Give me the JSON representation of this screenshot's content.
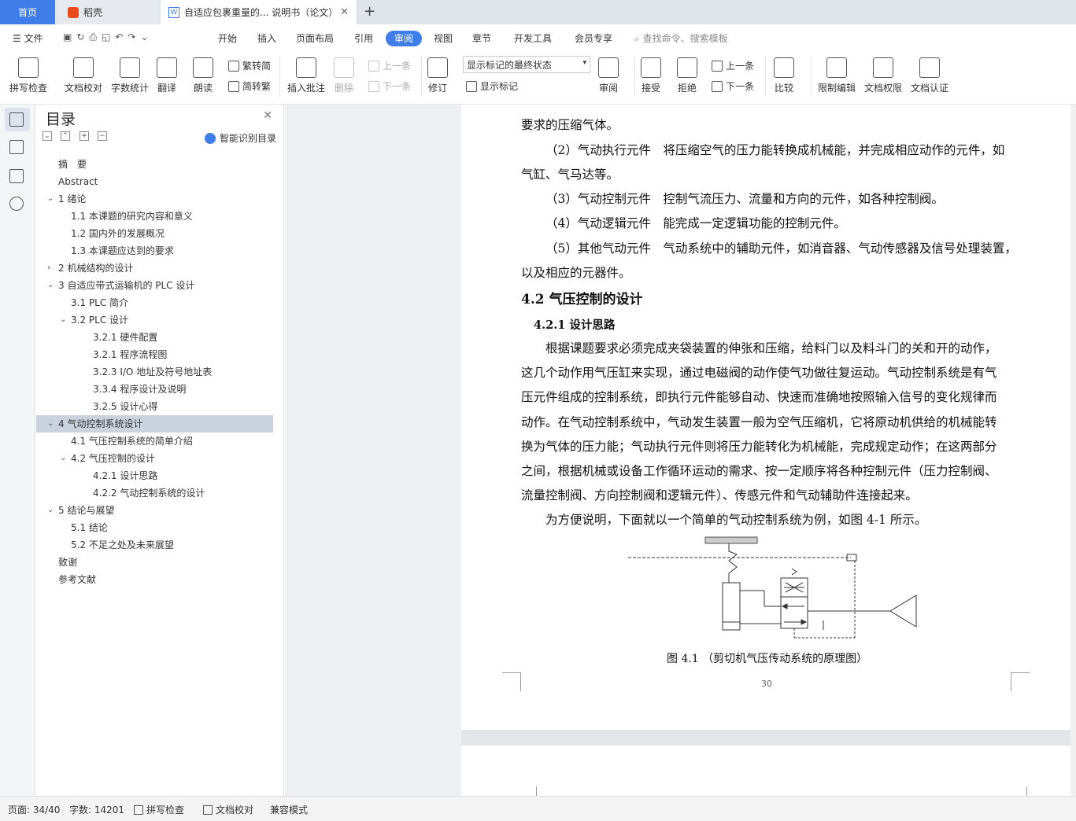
{
  "tabs": {
    "home": "首页",
    "daoke": "稻壳",
    "doc": "自适应包裹重量的... 说明书（论文）"
  },
  "menu": {
    "file": "文件",
    "items": [
      "开始",
      "插入",
      "页面布局",
      "引用",
      "审阅",
      "视图",
      "章节",
      "开发工具",
      "会员专享"
    ],
    "active": "审阅",
    "search": "查找命令、搜索模板"
  },
  "ribbon": {
    "spell": "拼写检查",
    "doc_check": "文档校对",
    "word_count": "字数统计",
    "translate": "翻译",
    "read": "朗读",
    "trad_simp": "繁转简",
    "simp_trad": "简转繁",
    "insert_comment": "插入批注",
    "delete": "删除",
    "prev1": "上一条",
    "next1": "下一条",
    "revise": "修订",
    "markup_state": "显示标记的最终状态",
    "show_markup": "显示标记",
    "review": "审阅",
    "accept": "接受",
    "reject": "拒绝",
    "prev2": "上一条",
    "next2": "下一条",
    "compare": "比较",
    "restrict": "限制编辑",
    "doc_perm": "文档权限",
    "doc_auth": "文档认证"
  },
  "toc": {
    "title": "目录",
    "smart": "智能识别目录",
    "items": [
      {
        "text": "摘　要",
        "level": 1
      },
      {
        "text": "Abstract",
        "level": 1
      },
      {
        "text": "1  绪论",
        "level": 1,
        "toggle": "open"
      },
      {
        "text": "1.1  本课题的研究内容和意义",
        "level": 2
      },
      {
        "text": "1.2  国内外的发展概况",
        "level": 2
      },
      {
        "text": "1.3  本课题应达到的要求",
        "level": 2
      },
      {
        "text": "2  机械结构的设计",
        "level": 1,
        "toggle": "closed"
      },
      {
        "text": "3  自适应带式运输机的 PLC 设计",
        "level": 1,
        "toggle": "open"
      },
      {
        "text": "3.1 PLC 简介",
        "level": 2
      },
      {
        "text": "3.2 PLC 设计",
        "level": 2,
        "toggle": "open"
      },
      {
        "text": "3.2.1  硬件配置",
        "level": 3
      },
      {
        "text": "3.2.1  程序流程图",
        "level": 3
      },
      {
        "text": "3.2.3 I/O 地址及符号地址表",
        "level": 3
      },
      {
        "text": "3.3.4  程序设计及说明",
        "level": 3
      },
      {
        "text": "3.2.5  设计心得",
        "level": 3
      },
      {
        "text": "4  气动控制系统设计",
        "level": 1,
        "toggle": "open",
        "selected": true
      },
      {
        "text": "4.1  气压控制系统的简单介绍",
        "level": 2
      },
      {
        "text": "4.2  气压控制的设计",
        "level": 2,
        "toggle": "open"
      },
      {
        "text": "4.2.1  设计思路",
        "level": 3
      },
      {
        "text": "4.2.2  气动控制系统的设计",
        "level": 3
      },
      {
        "text": "5  结论与展望",
        "level": 1,
        "toggle": "open"
      },
      {
        "text": "5.1  结论",
        "level": 2
      },
      {
        "text": "5.2  不足之处及未来展望",
        "level": 2
      },
      {
        "text": "致谢",
        "level": 1
      },
      {
        "text": "参考文献",
        "level": 1
      }
    ]
  },
  "doc": {
    "lines": [
      {
        "text": "要求的压缩气体。"
      },
      {
        "text": "（2）气动执行元件　将压缩空气的压力能转换成机械能，并完成相应动作的元件，如"
      },
      {
        "text": "气缸、气马达等。"
      },
      {
        "text": "（3）气动控制元件　控制气流压力、流量和方向的元件，如各种控制阀。"
      },
      {
        "text": "（4）气动逻辑元件　能完成一定逻辑功能的控制元件。"
      },
      {
        "text": "（5）其他气动元件　气动系统中的辅助元件，如消音器、气动传感器及信号处理装置，"
      },
      {
        "text": "以及相应的元器件。"
      }
    ],
    "h2": "4.2  气压控制的设计",
    "h3": "4.2.1  设计思路",
    "body": [
      {
        "text": "根据课题要求必须完成夹袋装置的伸张和压缩，给料门以及料斗门的关和开的动作，"
      },
      {
        "text": "这几个动作用气压缸来实现，通过电磁阀的动作使气功做往复运动。气动控制系统是有气"
      },
      {
        "text": "压元件组成的控制系统，即执行元件能够自动、快速而准确地按照输入信号的变化规律而"
      },
      {
        "text": "动作。在气动控制系统中，气动发生装置一般为空气压缩机，它将原动机供给的机械能转"
      },
      {
        "text": "换为气体的压力能；气动执行元件则将压力能转化为机械能，完成规定动作；在这两部分"
      },
      {
        "text": "之间，根据机械或设备工作循环运动的需求、按一定顺序将各种控制元件（压力控制阀、"
      },
      {
        "text": "流量控制阀、方向控制阀和逻辑元件）、传感元件和气动辅助件连接起来。"
      },
      {
        "text": "为方便说明，下面就以一个简单的气动控制系统为例，如图 4-1 所示。"
      }
    ],
    "caption": "图 4.1 （剪切机气压传动系统的原理图）",
    "page_number": "30"
  },
  "status": {
    "page": "页面: 34/40",
    "words": "字数: 14201",
    "spell": "拼写检查",
    "check": "文档校对",
    "compat": "兼容模式"
  }
}
